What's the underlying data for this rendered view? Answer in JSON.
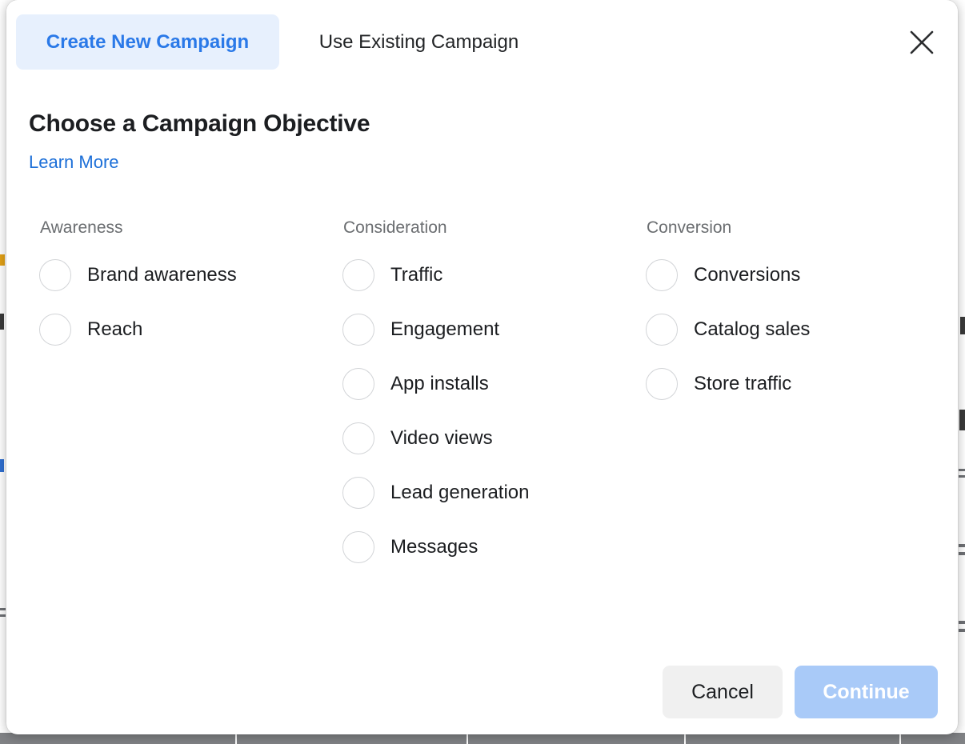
{
  "modal": {
    "tabs": [
      {
        "label": "Create New Campaign",
        "active": true
      },
      {
        "label": "Use Existing Campaign",
        "active": false
      }
    ],
    "close_icon": "close-icon",
    "title": "Choose a Campaign Objective",
    "learn_more_label": "Learn More",
    "columns": [
      {
        "heading": "Awareness",
        "options": [
          {
            "label": "Brand awareness",
            "selected": false
          },
          {
            "label": "Reach",
            "selected": false
          }
        ]
      },
      {
        "heading": "Consideration",
        "options": [
          {
            "label": "Traffic",
            "selected": false
          },
          {
            "label": "Engagement",
            "selected": false
          },
          {
            "label": "App installs",
            "selected": false
          },
          {
            "label": "Video views",
            "selected": false
          },
          {
            "label": "Lead generation",
            "selected": false
          },
          {
            "label": "Messages",
            "selected": false
          }
        ]
      },
      {
        "heading": "Conversion",
        "options": [
          {
            "label": "Conversions",
            "selected": false
          },
          {
            "label": "Catalog sales",
            "selected": false
          },
          {
            "label": "Store traffic",
            "selected": false
          }
        ]
      }
    ],
    "footer": {
      "cancel_label": "Cancel",
      "continue_label": "Continue",
      "continue_disabled": true
    }
  },
  "colors": {
    "accent_blue": "#2a79e8",
    "link_blue": "#1c6fd8",
    "active_tab_bg": "#e7f0fd",
    "continue_disabled_bg": "#a9caf8",
    "cancel_bg": "#f0f0f0",
    "text_primary": "#1c1e21",
    "text_muted": "#6a6d70",
    "radio_border": "#d2d4d7"
  }
}
